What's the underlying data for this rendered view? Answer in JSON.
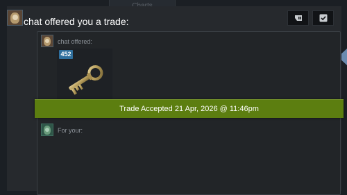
{
  "background_tab": {
    "label": "Charts"
  },
  "header": {
    "title": "chat offered you a trade:",
    "buttons": [
      {
        "icon": "ticket-icon"
      },
      {
        "icon": "checkmark-icon"
      }
    ]
  },
  "offer": {
    "label": "chat offered:",
    "item": {
      "icon": "key-icon",
      "quantity": "452"
    }
  },
  "status": {
    "text": "Trade Accepted 21 Apr, 2026 @ 11:46pm"
  },
  "your_side": {
    "label": "For your:"
  },
  "colors": {
    "accept_green": "#5c7e10",
    "quantity_badge": "#2f6f9d",
    "panel": "#26292d"
  }
}
